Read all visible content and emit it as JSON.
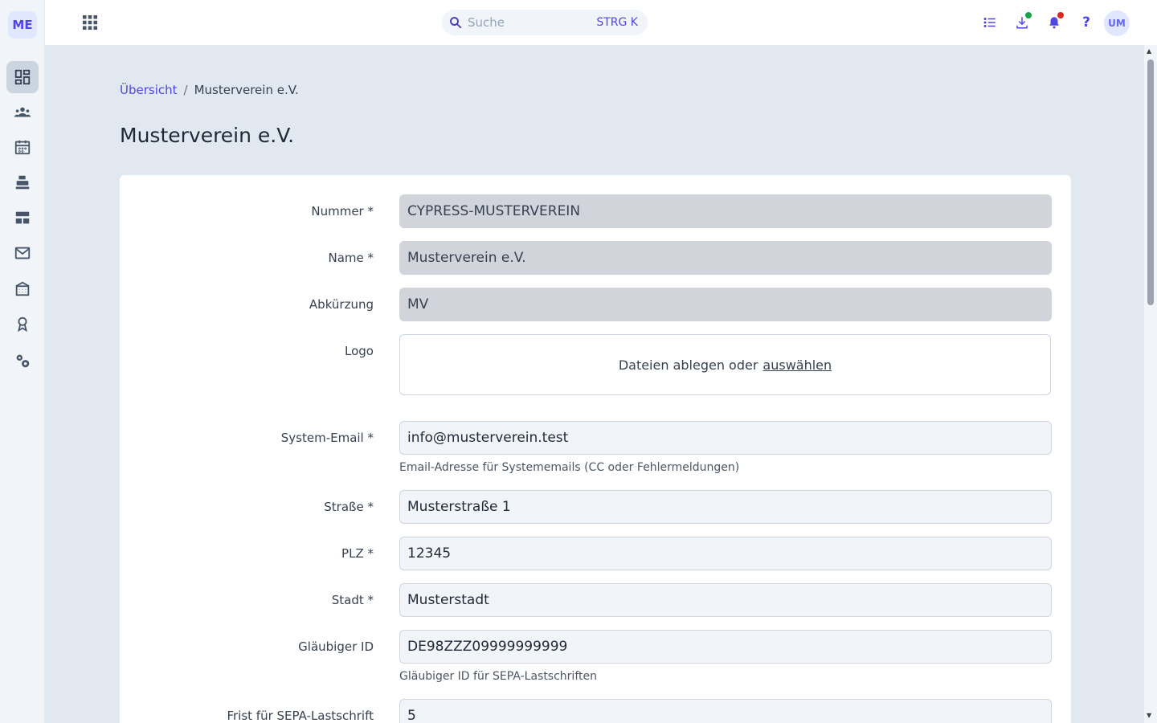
{
  "sidebar": {
    "logo": "ME",
    "items": [
      {
        "name": "dashboard-icon"
      },
      {
        "name": "members-icon"
      },
      {
        "name": "calendar-icon"
      },
      {
        "name": "cash-register-icon"
      },
      {
        "name": "layout-icon"
      },
      {
        "name": "mail-icon"
      },
      {
        "name": "building-icon"
      },
      {
        "name": "award-icon"
      },
      {
        "name": "settings-icon"
      }
    ]
  },
  "topbar": {
    "search_placeholder": "Suche",
    "search_shortcut": "STRG K",
    "avatar": "UM"
  },
  "breadcrumb": {
    "home": "Übersicht",
    "separator": "/",
    "current": "Musterverein e.V."
  },
  "page_title": "Musterverein e.V.",
  "form": {
    "nummer": {
      "label": "Nummer *",
      "value": "CYPRESS-MUSTERVEREIN"
    },
    "name": {
      "label": "Name *",
      "value": "Musterverein e.V."
    },
    "abkuerzung": {
      "label": "Abkürzung",
      "value": "MV"
    },
    "logo": {
      "label": "Logo",
      "dropzone_text": "Dateien ablegen oder",
      "dropzone_link": "auswählen"
    },
    "system_email": {
      "label": "System-Email *",
      "value": "info@musterverein.test",
      "hint": "Email-Adresse für Systememails (CC oder Fehlermeldungen)"
    },
    "strasse": {
      "label": "Straße *",
      "value": "Musterstraße 1"
    },
    "plz": {
      "label": "PLZ *",
      "value": "12345"
    },
    "stadt": {
      "label": "Stadt *",
      "value": "Musterstadt"
    },
    "glaeubiger_id": {
      "label": "Gläubiger ID",
      "value": "DE98ZZZ09999999999",
      "hint": "Gläubiger ID für SEPA-Lastschriften"
    },
    "frist_sepa": {
      "label": "Frist für SEPA-Lastschrift",
      "value": "5"
    }
  },
  "colors": {
    "accent": "#4f46e5",
    "notification_dot_green": "#16a34a",
    "notification_dot_red": "#dc2626"
  }
}
